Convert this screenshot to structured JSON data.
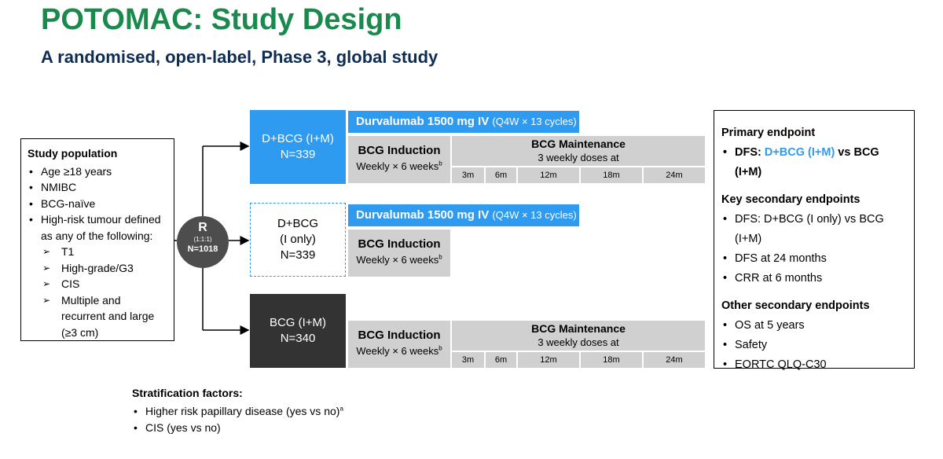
{
  "title": "POTOMAC: Study Design",
  "subtitle": "A randomised, open-label, Phase 3, global study",
  "population": {
    "header": "Study population",
    "items": [
      "Age ≥18 years",
      "NMIBC",
      "BCG-naïve",
      "High-risk tumour defined as any of the following:"
    ],
    "sub_items": [
      "T1",
      "High-grade/G3",
      "CIS",
      "Multiple and recurrent and large (≥3 cm)"
    ],
    "highlight_color": "#f7ea1b"
  },
  "randomisation": {
    "label": "R",
    "ratio": "(1:1:1)",
    "n": "N=1018"
  },
  "arms": [
    {
      "name": "D+BCG (I+M)",
      "n": "N=339"
    },
    {
      "name_line1": "D+BCG",
      "name_line2": "(I only)",
      "n": "N=339"
    },
    {
      "name": "BCG (I+M)",
      "n": "N=340"
    }
  ],
  "durvalumab": {
    "label": "Durvalumab 1500 mg IV",
    "regimen": "(Q4W × 13 cycles)"
  },
  "induction": {
    "label": "BCG Induction",
    "detail": "Weekly × 6 weeks",
    "footnote": "b"
  },
  "maintenance": {
    "label": "BCG Maintenance",
    "detail": "3 weekly doses at",
    "months": [
      "3m",
      "6m",
      "12m",
      "18m",
      "24m"
    ]
  },
  "endpoints": {
    "primary_header": "Primary endpoint",
    "primary": {
      "prefix": "DFS: ",
      "highlight": "D+BCG (I+M)",
      "suffix": " vs BCG (I+M)"
    },
    "key_header": "Key secondary endpoints",
    "key": [
      "DFS: D+BCG (I only) vs BCG (I+M)",
      "DFS at 24 months",
      "CRR at 6 months"
    ],
    "other_header": "Other secondary endpoints",
    "other": [
      "OS at 5 years",
      "Safety",
      "EORTC QLQ-C30"
    ]
  },
  "stratification": {
    "header": "Stratification factors:",
    "items": [
      {
        "text": "Higher risk papillary disease (yes vs no)",
        "footnote": "a"
      },
      {
        "text": "CIS (yes vs no)",
        "footnote": ""
      }
    ]
  },
  "colors": {
    "title": "#1a8a4c",
    "subtitle": "#0f2d52",
    "blue": "#2e9bf0",
    "dark": "#333333",
    "grey": "#d0d0d0"
  }
}
